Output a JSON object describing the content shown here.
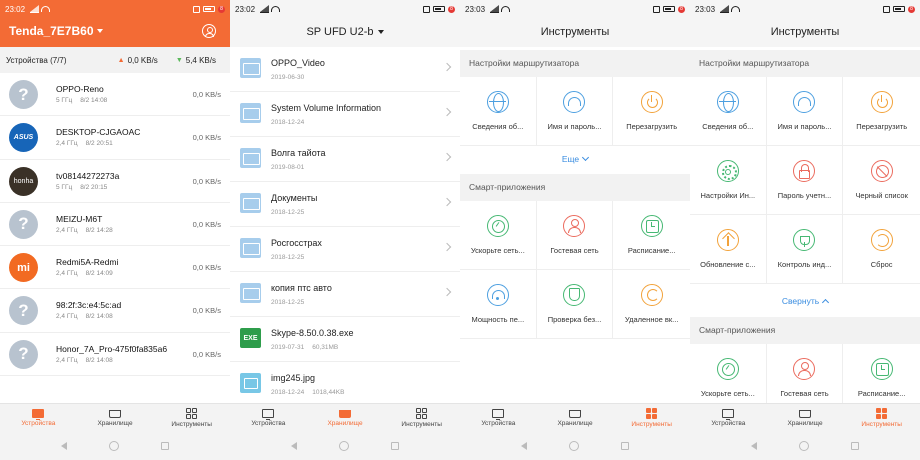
{
  "status": {
    "s1": {
      "time": "23:02",
      "battery_badge": "8"
    },
    "s2": {
      "time": "23:02",
      "battery_badge": "8"
    },
    "s3": {
      "time": "23:03",
      "battery_badge": "8"
    },
    "s4": {
      "time": "23:03",
      "battery_badge": "8"
    }
  },
  "devices_screen": {
    "title": "Tenda_7E7B60",
    "devices_label": "Устройства (7/7)",
    "upload_speed": "0,0  KB/s",
    "download_speed": "5,4  KB/s",
    "devices": [
      {
        "name": "OPPO-Reno",
        "band": "5 ГГц",
        "time": "8/2 14:08",
        "speed": "0,0  KB/s",
        "avatar": "question"
      },
      {
        "name": "DESKTOP-CJGAOAC",
        "band": "2,4 ГГц",
        "time": "8/2 20:51",
        "speed": "0,0  KB/s",
        "avatar": "asus",
        "avatar_text": "ASUS"
      },
      {
        "name": "tv08144272273a",
        "band": "5 ГГц",
        "time": "8/2 20:15",
        "speed": "0,0  KB/s",
        "avatar": "honor",
        "avatar_text": "honha"
      },
      {
        "name": "MEIZU-M6T",
        "band": "2,4 ГГц",
        "time": "8/2 14:28",
        "speed": "0,0  KB/s",
        "avatar": "question"
      },
      {
        "name": "Redmi5A-Redmi",
        "band": "2,4 ГГц",
        "time": "8/2 14:09",
        "speed": "0,0  KB/s",
        "avatar": "mi",
        "avatar_text": "mi"
      },
      {
        "name": "98:2f:3c:e4:5c:ad",
        "band": "2,4 ГГц",
        "time": "8/2 14:08",
        "speed": "0,0  KB/s",
        "avatar": "question"
      },
      {
        "name": "Honor_7A_Pro-475f0fa835a6",
        "band": "2,4 ГГц",
        "time": "8/2 14:08",
        "speed": "0,0  KB/s",
        "avatar": "question"
      }
    ]
  },
  "storage_screen": {
    "title": "SP UFD U2-b",
    "files": [
      {
        "name": "OPPO_Video",
        "date": "2019-06-30",
        "size": "",
        "type": "folder"
      },
      {
        "name": "System Volume Information",
        "date": "2018-12-24",
        "size": "",
        "type": "folder"
      },
      {
        "name": "Волга тайота",
        "date": "2019-08-01",
        "size": "",
        "type": "folder"
      },
      {
        "name": "Документы",
        "date": "2018-12-25",
        "size": "",
        "type": "folder"
      },
      {
        "name": "Росгосстрах",
        "date": "2018-12-25",
        "size": "",
        "type": "folder"
      },
      {
        "name": "копия птс авто",
        "date": "2018-12-25",
        "size": "",
        "type": "folder"
      },
      {
        "name": "Skype-8.50.0.38.exe",
        "date": "2019-07-31",
        "size": "60,31MB",
        "type": "exe",
        "icon_text": "EXE"
      },
      {
        "name": "img245.jpg",
        "date": "2018-12-24",
        "size": "1018,44KB",
        "type": "image"
      }
    ]
  },
  "tools_collapsed": {
    "title": "Инструменты",
    "router_section": "Настройки маршрутизатора",
    "router_items": [
      {
        "label": "Сведения об...",
        "icon": "globe-icon"
      },
      {
        "label": "Имя и пароль...",
        "icon": "wifi-icon"
      },
      {
        "label": "Перезагрузить",
        "icon": "power-icon"
      }
    ],
    "more_label": "Еще",
    "smart_section": "Смарт-приложения",
    "smart_items": [
      {
        "label": "Ускорьте сеть...",
        "icon": "speed-gauge-icon"
      },
      {
        "label": "Гостевая сеть",
        "icon": "guest-icon"
      },
      {
        "label": "Расписание...",
        "icon": "schedule-icon"
      },
      {
        "label": "Мощность пе...",
        "icon": "signal-icon"
      },
      {
        "label": "Проверка без...",
        "icon": "shield-icon"
      },
      {
        "label": "Удаленное вк...",
        "icon": "moon-icon"
      }
    ]
  },
  "tools_expanded": {
    "title": "Инструменты",
    "router_section": "Настройки маршрутизатора",
    "router_items": [
      {
        "label": "Сведения об...",
        "icon": "globe-icon"
      },
      {
        "label": "Имя и пароль...",
        "icon": "wifi-icon"
      },
      {
        "label": "Перезагрузить",
        "icon": "power-icon"
      },
      {
        "label": "Настройки Ин...",
        "icon": "gear-icon"
      },
      {
        "label": "Пароль учетн...",
        "icon": "lock-icon"
      },
      {
        "label": "Черный список",
        "icon": "blacklist-icon"
      },
      {
        "label": "Обновление с...",
        "icon": "upgrade-icon"
      },
      {
        "label": "Контроль инд...",
        "icon": "plug-icon"
      },
      {
        "label": "Сброс",
        "icon": "reset-icon"
      }
    ],
    "collapse_label": "Свернуть",
    "smart_section": "Смарт-приложения",
    "smart_items": [
      {
        "label": "Ускорьте сеть...",
        "icon": "speed-gauge-icon"
      },
      {
        "label": "Гостевая сеть",
        "icon": "guest-icon"
      },
      {
        "label": "Расписание...",
        "icon": "schedule-icon"
      }
    ]
  },
  "tabbar": {
    "devices": "Устройства",
    "storage": "Хранилище",
    "tools": "Инструменты"
  },
  "colors": {
    "accent": "#f36b35",
    "link": "#3a8de0",
    "asus": "#1765b8",
    "mi": "#f26a22"
  }
}
